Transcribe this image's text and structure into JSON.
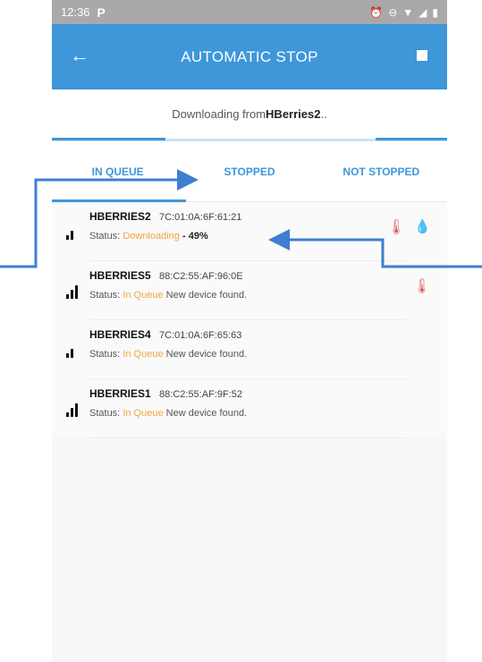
{
  "statusbar": {
    "time": "12:36",
    "app_icon": "P",
    "right_icons": [
      "alarm-icon",
      "minus-circle-icon",
      "wifi-icon",
      "signal-icon",
      "battery-icon"
    ]
  },
  "appbar": {
    "title": "AUTOMATIC STOP",
    "back_icon": "back-arrow-icon",
    "stop_icon": "stop-square-icon"
  },
  "download": {
    "prefix": "Downloading from ",
    "device": "HBerries2",
    "suffix": ".."
  },
  "tabs": [
    {
      "label": "IN QUEUE"
    },
    {
      "label": "STOPPED"
    },
    {
      "label": "NOT STOPPED"
    }
  ],
  "devices": [
    {
      "name": "HBERRIES2",
      "mac": "7C:01:0A:6F:61:21",
      "status_label": "Status:",
      "state": "Downloading",
      "extra": " - 49%",
      "signal": 2,
      "icons": [
        "thermometer-icon",
        "water-drop-icon"
      ]
    },
    {
      "name": "HBERRIES5",
      "mac": "88:C2:55:AF:96:0E",
      "status_label": "Status:",
      "state": "In Queue",
      "extra": "New device found.",
      "signal": 3,
      "icons": [
        "thermometer-icon"
      ]
    },
    {
      "name": "HBERRIES4",
      "mac": "7C:01:0A:6F:65:63",
      "status_label": "Status:",
      "state": "In Queue",
      "extra": "New device found.",
      "signal": 2,
      "icons": []
    },
    {
      "name": "HBERRIES1",
      "mac": "88:C2:55:AF:9F:52",
      "status_label": "Status:",
      "state": "In Queue",
      "extra": "New device found.",
      "signal": 3,
      "icons": []
    }
  ],
  "colors": {
    "accent": "#3d97d9",
    "warning": "#f0a640",
    "thermo": "#d9534f"
  }
}
